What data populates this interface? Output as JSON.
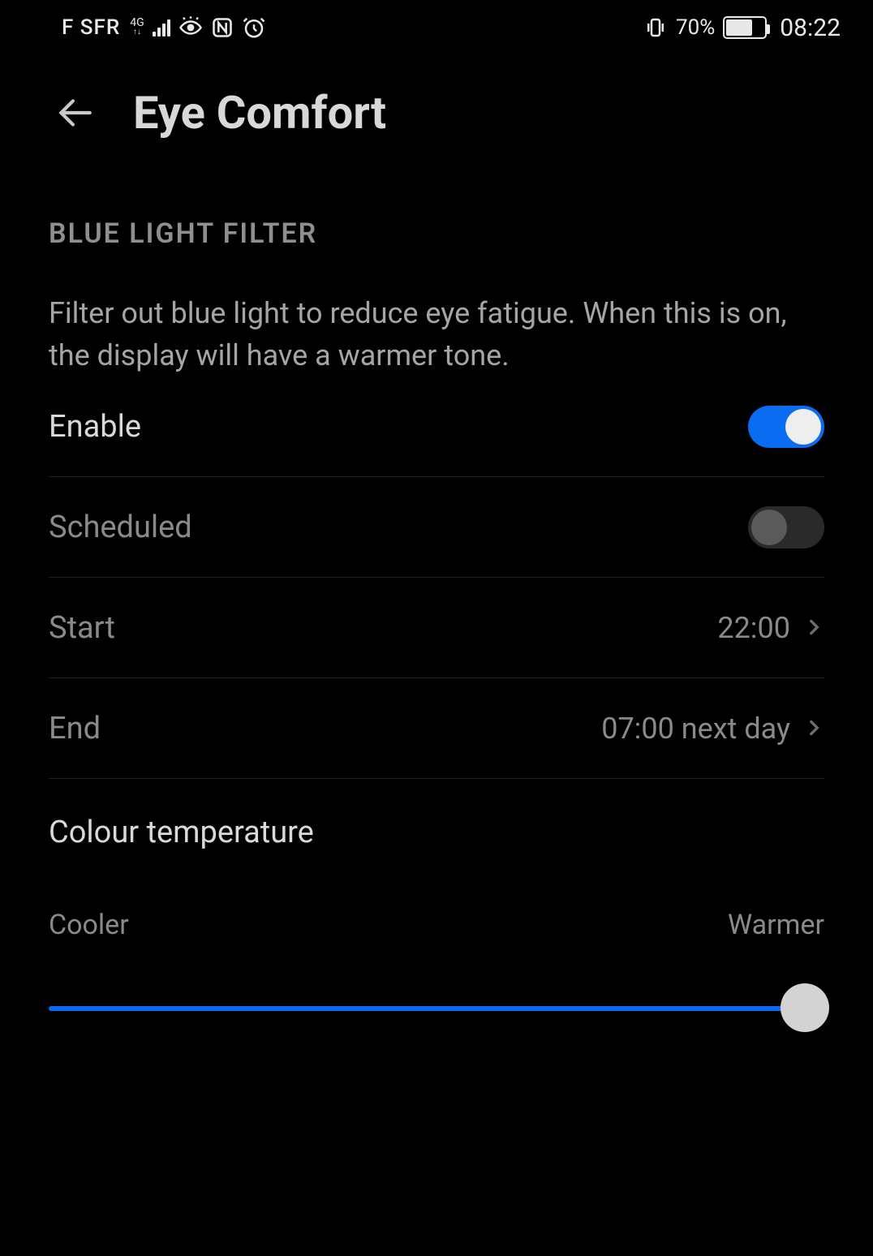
{
  "status_bar": {
    "carrier": "F SFR",
    "network": "4G",
    "icons": [
      "eye-comfort-icon",
      "nfc-icon",
      "alarm-icon"
    ],
    "vibrate_icon": "vibrate-icon",
    "battery_percent": "70%",
    "time": "08:22"
  },
  "header": {
    "title": "Eye Comfort"
  },
  "section": {
    "heading": "BLUE LIGHT FILTER",
    "description": "Filter out blue light to reduce eye fatigue. When this is on, the display will have a warmer tone."
  },
  "rows": {
    "enable": {
      "label": "Enable",
      "on": true
    },
    "scheduled": {
      "label": "Scheduled",
      "on": false
    },
    "start": {
      "label": "Start",
      "value": "22:00"
    },
    "end": {
      "label": "End",
      "value": "07:00 next day"
    }
  },
  "colour_temp": {
    "title": "Colour temperature",
    "cool_label": "Cooler",
    "warm_label": "Warmer",
    "position_percent": 100
  },
  "colors": {
    "accent": "#0a6cf1"
  }
}
